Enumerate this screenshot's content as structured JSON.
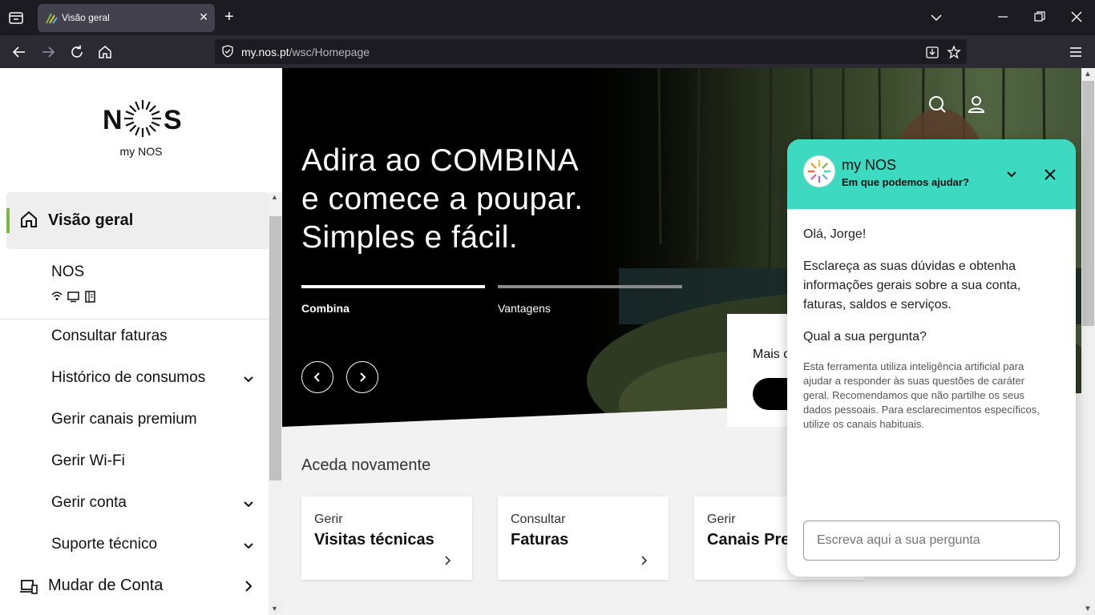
{
  "browser": {
    "tab_title": "Visão geral",
    "url_domain": "my.nos.pt",
    "url_path": "/wsc/Homepage"
  },
  "sidebar": {
    "logo_text": "NOS",
    "logo_sub": "my NOS",
    "active_item": "Visão geral",
    "account_name": "NOS",
    "items": [
      {
        "label": "Consultar faturas",
        "expandable": false
      },
      {
        "label": "Histórico de consumos",
        "expandable": true
      },
      {
        "label": "Gerir canais premium",
        "expandable": false
      },
      {
        "label": "Gerir Wi-Fi",
        "expandable": false
      },
      {
        "label": "Gerir conta",
        "expandable": true
      },
      {
        "label": "Suporte técnico",
        "expandable": true
      }
    ],
    "switch_account": "Mudar de Conta"
  },
  "hero": {
    "title_line1": "Adira ao COMBINA",
    "title_line2": "e comece a poupar.",
    "title_line3": "Simples e fácil.",
    "tabs": [
      {
        "label": "Combina",
        "active": true
      },
      {
        "label": "Vantagens",
        "active": false
      }
    ],
    "promo_text": "Mais c"
  },
  "quick_access": {
    "heading": "Aceda novamente",
    "cards": [
      {
        "line1": "Gerir",
        "line2": "Visitas técnicas"
      },
      {
        "line1": "Consultar",
        "line2": "Faturas"
      },
      {
        "line1": "Gerir",
        "line2": "Canais Pre"
      }
    ]
  },
  "chat": {
    "title": "my NOS",
    "subtitle": "Em que podemos ajudar?",
    "greeting": "Olá, Jorge!",
    "intro": "Esclareça as suas dúvidas e obtenha informações gerais sobre a sua conta, faturas, saldos e serviços.",
    "question": "Qual a sua pergunta?",
    "disclaimer": "Esta ferramenta utiliza inteligência artificial para ajudar a responder às suas questões de caráter geral. Recomendamos que não partilhe os seus dados pessoais. Para esclarecimentos específicos, utilize os canais habituais.",
    "input_placeholder": "Escreva aqui a sua pergunta"
  },
  "colors": {
    "accent_green": "#7ab648",
    "chat_header": "#3dd9c0",
    "browser_dark": "#1c1b22"
  }
}
